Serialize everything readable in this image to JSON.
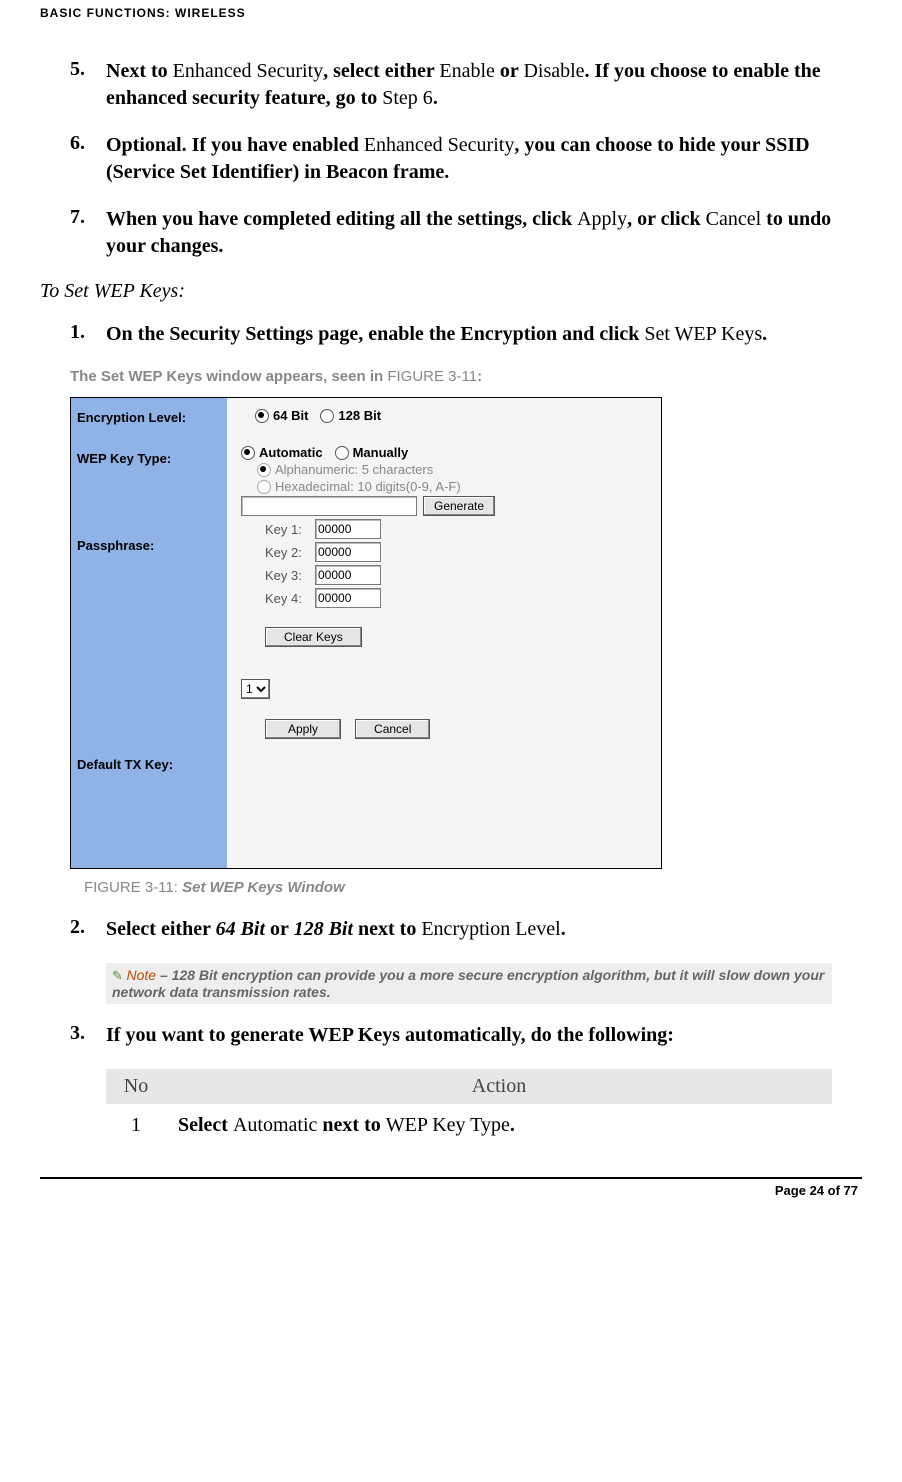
{
  "header": "BASIC FUNCTIONS: WIRELESS",
  "items5": {
    "num": "5.",
    "p1a": "Next to ",
    "p1b": "Enhanced Security",
    "p1c": ", select either ",
    "p1d": "Enable",
    "p1e": " or ",
    "p1f": "Disable",
    "p1g": ". If you choose to enable the enhanced security feature, go to ",
    "p1h": "Step 6",
    "p1i": "."
  },
  "items6": {
    "num": "6.",
    "p1a": "Optional. If you have enabled ",
    "p1b": "Enhanced Security",
    "p1c": ", you can choose to hide your SSID (Service Set Identifier) in Beacon frame."
  },
  "items7": {
    "num": "7.",
    "p1a": "When you have completed editing all the settings, click ",
    "p1b": "Apply",
    "p1c": ", or click ",
    "p1d": "Cancel",
    "p1e": " to undo your changes."
  },
  "subhead": "To Set WEP Keys:",
  "items1": {
    "num": "1.",
    "p1a": "On the Security Settings page, enable the Encryption and click ",
    "p1b": "Set WEP Keys",
    "p1c": "."
  },
  "gray_intro_a": "The Set WEP Keys window appears, seen in ",
  "gray_intro_b": "FIGURE 3-11",
  "gray_intro_c": ":",
  "win": {
    "labels": {
      "enc": "Encryption Level:",
      "type": "WEP Key Type:",
      "pass": "Passphrase:",
      "def": "Default TX Key:"
    },
    "opt_64": "64 Bit",
    "opt_128": "128 Bit",
    "opt_auto": "Automatic",
    "opt_man": "Manually",
    "opt_alpha": "Alphanumeric: 5 characters",
    "opt_hex": "Hexadecimal: 10 digits(0-9, A-F)",
    "gen": "Generate",
    "key1l": "Key 1:",
    "key1v": "00000",
    "key2l": "Key 2:",
    "key2v": "00000",
    "key3l": "Key 3:",
    "key3v": "00000",
    "key4l": "Key 4:",
    "key4v": "00000",
    "clear": "Clear Keys",
    "def_opt": "1",
    "apply": "Apply",
    "cancel": "Cancel"
  },
  "fig_caption_ref": "FIGURE 3-11: ",
  "fig_caption_title": "Set WEP Keys Window",
  "items2": {
    "num": "2.",
    "p1a": "Select either ",
    "p1b": "64 Bit",
    "p1c": " or ",
    "p1d": "128 Bit",
    "p1e": " next to ",
    "p1f": "Encryption Level",
    "p1g": "."
  },
  "note_label": "Note",
  "note_body": " – 128 Bit encryption can provide you a more secure encryption algorithm, but it will slow down your network data transmission rates.",
  "items3": {
    "num": "3.",
    "p1": "If you want to generate WEP Keys automatically, do the following:"
  },
  "table": {
    "h1": "No",
    "h2": "Action",
    "r1n": "1",
    "r1a": "Select ",
    "r1b": "Automatic",
    "r1c": " next to ",
    "r1d": "WEP Key Type",
    "r1e": "."
  },
  "footer": "Page 24 of 77"
}
